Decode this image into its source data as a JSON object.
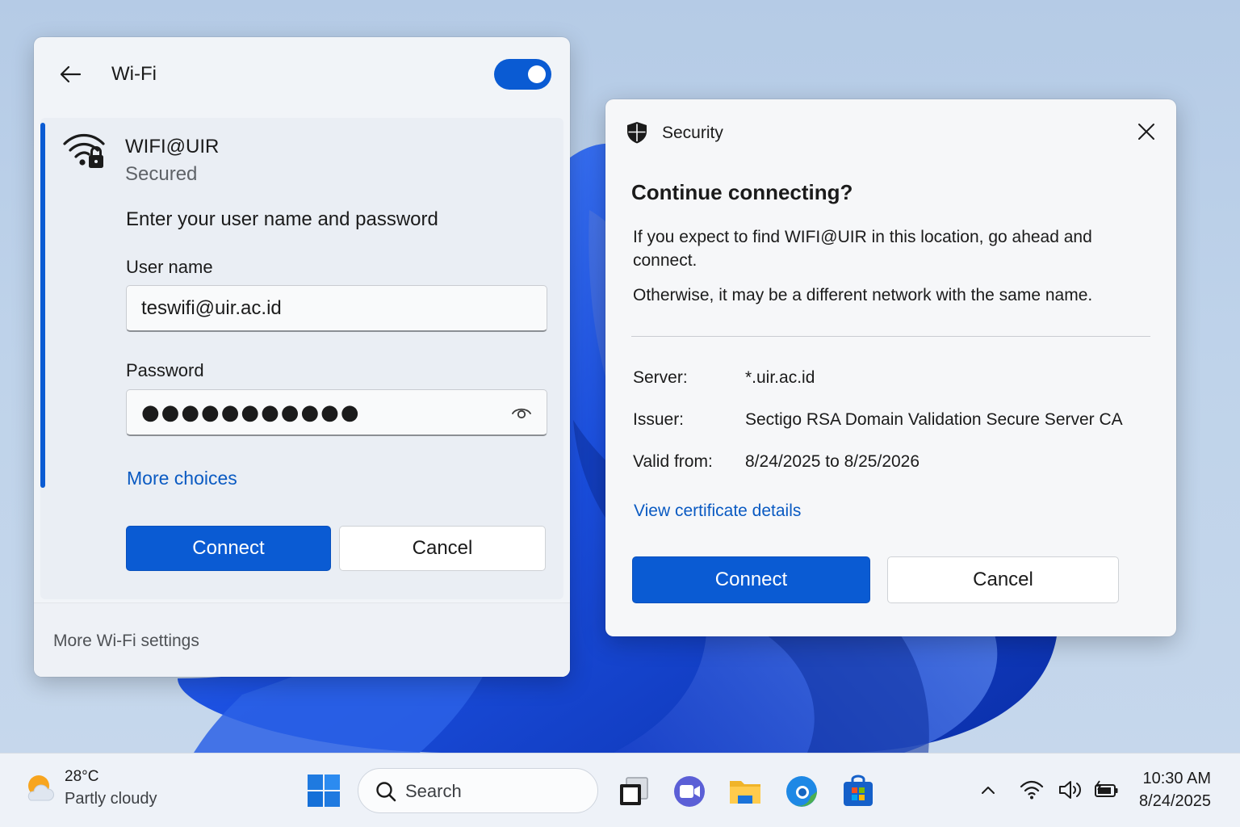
{
  "wifi_panel": {
    "title": "Wi-Fi",
    "toggle_on": true,
    "network": {
      "name": "WIFI@UIR",
      "status": "Secured",
      "prompt": "Enter your user name and password",
      "username_label": "User name",
      "username_value": "teswifi@uir.ac.id",
      "password_label": "Password",
      "password_masked": "●●●●●●●●●●●",
      "more_choices": "More choices",
      "connect_label": "Connect",
      "cancel_label": "Cancel"
    },
    "footer_link": "More Wi-Fi settings"
  },
  "security_dialog": {
    "title": "Security",
    "heading": "Continue connecting?",
    "message_1": "If you expect to find WIFI@UIR in this location, go ahead and connect.",
    "message_2": "Otherwise, it may be a different network with the same name.",
    "server_label": "Server:",
    "server_value": "*.uir.ac.id",
    "issuer_label": "Issuer:",
    "issuer_value": "Sectigo RSA Domain Validation Secure Server CA",
    "valid_label": "Valid from:",
    "valid_value": "8/24/2025 to 8/25/2026",
    "view_cert_link": "View certificate details",
    "connect_label": "Connect",
    "cancel_label": "Cancel"
  },
  "taskbar": {
    "weather_temp": "28°C",
    "weather_desc": "Partly cloudy",
    "search_placeholder": "Search",
    "time": "10:30 AM",
    "date": "8/24/2025",
    "pinned_apps": [
      "task-view-icon",
      "teams-icon",
      "file-explorer-icon",
      "edge-icon",
      "store-icon"
    ]
  },
  "colors": {
    "accent": "#0a5bd3",
    "link": "#0a5ac2",
    "wallpaper_blue": "#1a4fd8"
  }
}
